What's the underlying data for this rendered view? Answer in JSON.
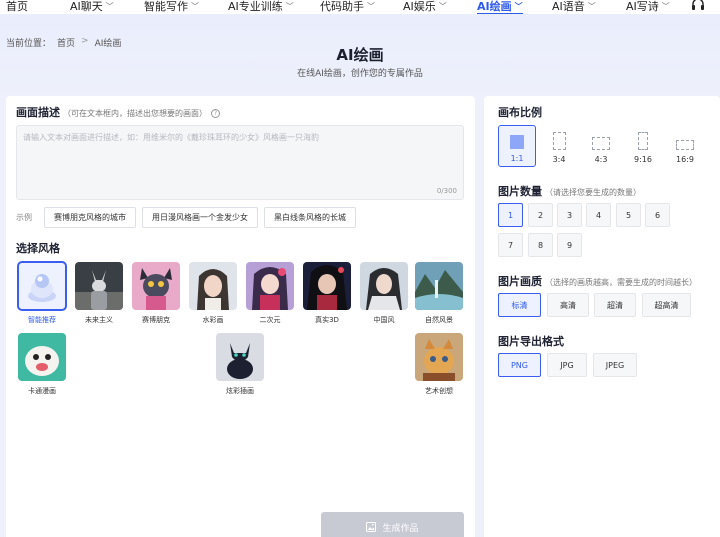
{
  "nav": {
    "items": [
      {
        "label": "首页",
        "chevron": false
      },
      {
        "label": "AI聊天",
        "chevron": true
      },
      {
        "label": "智能写作",
        "chevron": true
      },
      {
        "label": "AI专业训练",
        "chevron": true
      },
      {
        "label": "代码助手",
        "chevron": true
      },
      {
        "label": "AI娱乐",
        "chevron": true
      },
      {
        "label": "AI绘画",
        "chevron": true,
        "active": true
      },
      {
        "label": "AI语音",
        "chevron": true
      },
      {
        "label": "AI写诗",
        "chevron": true
      }
    ],
    "headset_icon": "headset-icon"
  },
  "breadcrumb": {
    "prefix": "当前位置：",
    "home": "首页",
    "separator": ">",
    "current": "AI绘画"
  },
  "header": {
    "title": "AI绘画",
    "subtitle": "在线AI绘画，创作您的专属作品"
  },
  "prompt": {
    "title": "画面描述",
    "hint": "（可在文本框内，描述出您想要的画面）",
    "placeholder": "请输入文本对画面进行描述，如：用维米尔的《戴珍珠耳环的少女》风格画一只海豹",
    "count": "0/300",
    "examples_label": "示例",
    "examples": [
      "赛博朋克风格的城市",
      "用日漫风格画一个金发少女",
      "黑白线条风格的长城"
    ]
  },
  "styles": {
    "title": "选择风格",
    "items": [
      {
        "label": "智能推荐",
        "selected": true
      },
      {
        "label": "未来主义"
      },
      {
        "label": "赛博朋克"
      },
      {
        "label": "水彩画"
      },
      {
        "label": "二次元"
      },
      {
        "label": "真实3D"
      },
      {
        "label": "中国风"
      },
      {
        "label": "自然风景"
      },
      {
        "label": "卡通漫画"
      },
      {
        "label": "炫彩插画"
      },
      {
        "label": "艺术创想"
      }
    ]
  },
  "generate": {
    "label": "生成作品"
  },
  "ratio": {
    "title": "画布比例",
    "options": [
      {
        "label": "1:1",
        "selected": true
      },
      {
        "label": "3:4"
      },
      {
        "label": "4:3"
      },
      {
        "label": "9:16"
      },
      {
        "label": "16:9"
      }
    ]
  },
  "count": {
    "title": "图片数量",
    "hint": "（请选择您要生成的数量）",
    "options": [
      "1",
      "2",
      "3",
      "4",
      "5",
      "6",
      "7",
      "8",
      "9"
    ],
    "selected": "1"
  },
  "quality": {
    "title": "图片画质",
    "hint": "（选择的画质越高，需要生成的时间越长）",
    "options": [
      "标清",
      "高清",
      "超清",
      "超高清"
    ],
    "selected": "标清"
  },
  "format": {
    "title": "图片导出格式",
    "options": [
      "PNG",
      "JPG",
      "JPEG"
    ],
    "selected": "PNG"
  },
  "colors": {
    "accent": "#3b5ef0",
    "button_disabled": "#c7cad3",
    "background": "#eef1fb"
  }
}
